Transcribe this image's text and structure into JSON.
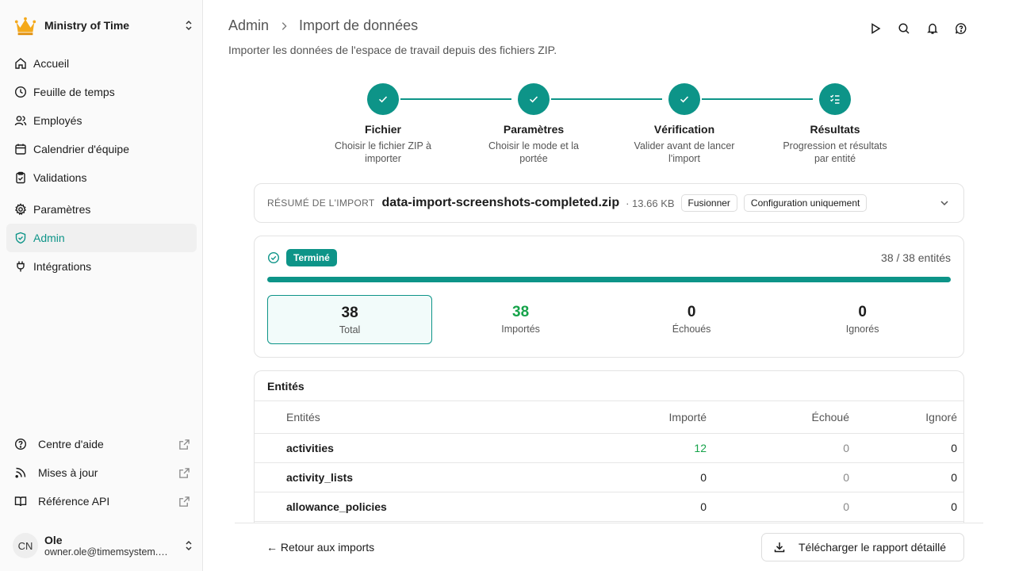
{
  "workspace": {
    "name": "Ministry of Time"
  },
  "nav": [
    {
      "label": "Accueil",
      "icon": "home-icon"
    },
    {
      "label": "Feuille de temps",
      "icon": "clock-icon"
    },
    {
      "label": "Employés",
      "icon": "users-icon"
    },
    {
      "label": "Calendrier d'équipe",
      "icon": "calendar-icon"
    },
    {
      "label": "Validations",
      "icon": "clipboard-check-icon"
    },
    {
      "label": "Paramètres",
      "icon": "gear-icon"
    },
    {
      "label": "Admin",
      "icon": "shield-check-icon",
      "active": true
    },
    {
      "label": "Intégrations",
      "icon": "plug-icon"
    }
  ],
  "bottom_links": [
    {
      "label": "Centre d'aide",
      "icon": "help-circle-icon"
    },
    {
      "label": "Mises à jour",
      "icon": "rss-icon"
    },
    {
      "label": "Référence API",
      "icon": "book-icon"
    }
  ],
  "user": {
    "initials": "CN",
    "name": "Ole",
    "email": "owner.ole@timemsystem.com"
  },
  "header": {
    "crumb_root": "Admin",
    "crumb_current": "Import de données",
    "subtitle": "Importer les données de l'espace de travail depuis des fichiers ZIP."
  },
  "steps": [
    {
      "label": "Fichier",
      "desc": "Choisir le fichier ZIP à importer"
    },
    {
      "label": "Paramètres",
      "desc": "Choisir le mode et la portée"
    },
    {
      "label": "Vérification",
      "desc": "Valider avant de lancer l'import"
    },
    {
      "label": "Résultats",
      "desc": "Progression et résultats par entité"
    }
  ],
  "summary": {
    "label": "RÉSUMÉ DE L'IMPORT",
    "file": "data-import-screenshots-completed.zip",
    "size": "· 13.66 KB",
    "mode": "Fusionner",
    "scope": "Configuration uniquement"
  },
  "progress": {
    "status": "Terminé",
    "count": "38 / 38 entités",
    "fraction": 1.0,
    "stats": [
      {
        "value": "38",
        "label": "Total"
      },
      {
        "value": "38",
        "label": "Importés"
      },
      {
        "value": "0",
        "label": "Échoués"
      },
      {
        "value": "0",
        "label": "Ignorés"
      }
    ]
  },
  "table": {
    "title": "Entités",
    "headers": [
      "Entités",
      "Importé",
      "Échoué",
      "Ignoré"
    ],
    "rows": [
      [
        "activities",
        "12",
        "0",
        "0"
      ],
      [
        "activity_lists",
        "0",
        "0",
        "0"
      ],
      [
        "allowance_policies",
        "0",
        "0",
        "0"
      ]
    ]
  },
  "footer": {
    "back": "← Retour aux imports",
    "download": "Télécharger le rapport détaillé"
  },
  "colors": {
    "accent": "#0d9488",
    "success": "#16a34a"
  }
}
